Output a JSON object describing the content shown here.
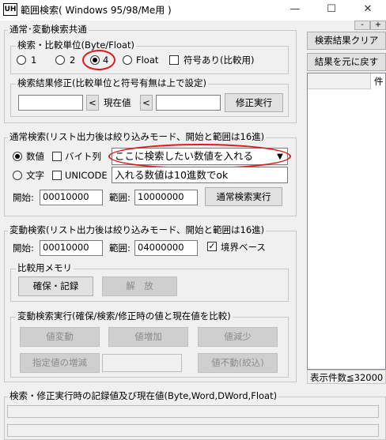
{
  "window": {
    "title": "範囲検索( Windows 95/98/Me用 )",
    "icon_text": "UH",
    "controls": {
      "minimize": "—",
      "maximize": "☐",
      "close": "✕"
    }
  },
  "common": {
    "title": "通常･変動検索共通",
    "unit": {
      "title": "検索・比較単位(Byte/Float)",
      "radios": [
        "1",
        "2",
        "4",
        "Float"
      ],
      "selected": "4",
      "signed_label": "符号あり(比較用)"
    },
    "fix": {
      "title": "検索結果修正(比較単位と符号有無は上で設定)",
      "arrow1": "<",
      "current_label": "現在値",
      "arrow2": "<",
      "button": "修正実行"
    }
  },
  "normal": {
    "title": "通常検索(リスト出力後は絞り込みモード、開始と範囲は16進)",
    "numeric_label": "数値",
    "bytes_label": "バイト列",
    "combo_value": "ここに検索したい数値を入れる",
    "text_label": "文字",
    "unicode_label": "UNICODE",
    "annotation": "入れる数値は10進数でok",
    "start_label": "開始:",
    "start_value": "00010000",
    "range_label": "範囲:",
    "range_value": "10000000",
    "run_button": "通常検索実行"
  },
  "variable": {
    "title": "変動検索(リスト出力後は絞り込みモード、開始と範囲は16進)",
    "start_label": "開始:",
    "start_value": "00010000",
    "range_label": "範囲:",
    "range_value": "04000000",
    "boundary_label": "境界ベース",
    "boundary_checked": true,
    "memory": {
      "title": "比較用メモリ",
      "save_button": "確保・記録",
      "release_button": "解　放"
    },
    "exec": {
      "title": "変動検索実行(確保/検索/修正時の値と現在値を比較)",
      "changed": "値変動",
      "increased": "値増加",
      "decreased": "値減少",
      "specified": "指定値の増減",
      "unchanged": "値不動(絞込)"
    }
  },
  "right": {
    "minus": "-",
    "plus": "+",
    "clear_button": "検索結果クリア",
    "restore_button": "結果を元に戻す",
    "list_header": "件",
    "status": "表示件数≦32000"
  },
  "bottom": {
    "title": "検索・修正実行時の記録値及び現在値(Byte,Word,DWord,Float)"
  }
}
